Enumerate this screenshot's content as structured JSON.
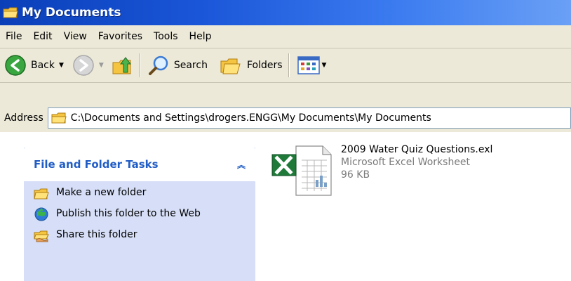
{
  "window": {
    "title": "My Documents"
  },
  "menu": {
    "items": [
      "File",
      "Edit",
      "View",
      "Favorites",
      "Tools",
      "Help"
    ]
  },
  "toolbar": {
    "back_label": "Back",
    "search_label": "Search",
    "folders_label": "Folders"
  },
  "address": {
    "label": "Address",
    "value": "C:\\Documents and Settings\\drogers.ENGG\\My Documents\\My Documents"
  },
  "tasks": {
    "title": "File and Folder Tasks",
    "items": [
      {
        "label": "Make a new folder",
        "icon": "new-folder-icon"
      },
      {
        "label": "Publish this folder to the Web",
        "icon": "publish-web-icon"
      },
      {
        "label": "Share this folder",
        "icon": "share-folder-icon"
      }
    ]
  },
  "file": {
    "name": "2009 Water Quiz Questions.exl",
    "type": "Microsoft Excel Worksheet",
    "size": "96 KB",
    "icon": "excel-file-icon"
  },
  "colors": {
    "title_bar": "#0a3fb8",
    "chrome": "#ece9d8",
    "task_header_text": "#215dc6",
    "task_panel": "#d6dff7"
  }
}
